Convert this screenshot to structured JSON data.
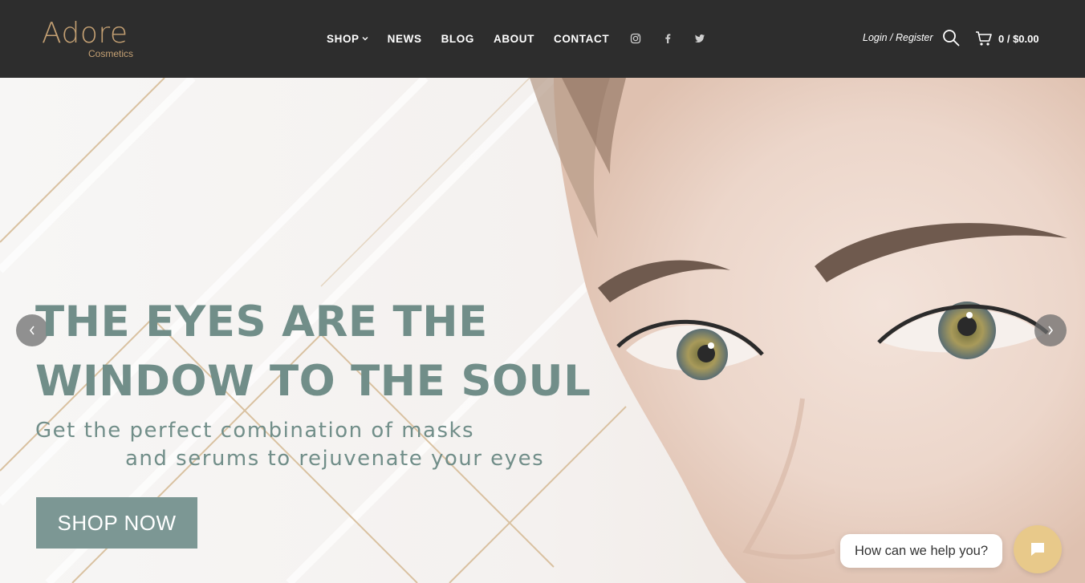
{
  "brand": {
    "name": "Adore",
    "tagline": "Cosmetics",
    "color": "#c4a073"
  },
  "nav": {
    "items": [
      {
        "label": "SHOP",
        "icon": "chevron-down-icon"
      },
      {
        "label": "NEWS"
      },
      {
        "label": "BLOG"
      },
      {
        "label": "ABOUT"
      },
      {
        "label": "CONTACT"
      }
    ],
    "social": [
      "instagram-icon",
      "facebook-icon",
      "twitter-icon"
    ]
  },
  "account": {
    "login_register": "Login / Register"
  },
  "search": {
    "icon": "search-icon"
  },
  "cart": {
    "icon": "cart-icon",
    "summary": "0 / $0.00"
  },
  "hero": {
    "headline": [
      "THE EYES ARE THE",
      "WINDOW TO THE SOUL"
    ],
    "subtitle": [
      "Get the perfect combination of masks",
      "and serums to rejuvenate your eyes"
    ],
    "cta_label": "SHOP NOW",
    "text_color": "#718e89",
    "button_color": "#7c9794",
    "prev_icon": "chevron-left-icon",
    "next_icon": "chevron-right-icon"
  },
  "chat": {
    "prompt": "How can we help you?",
    "icon": "chat-icon",
    "color": "#e8c98a"
  },
  "colors": {
    "header_bg": "#2d2d2d",
    "accent_gold": "#c4a073"
  }
}
